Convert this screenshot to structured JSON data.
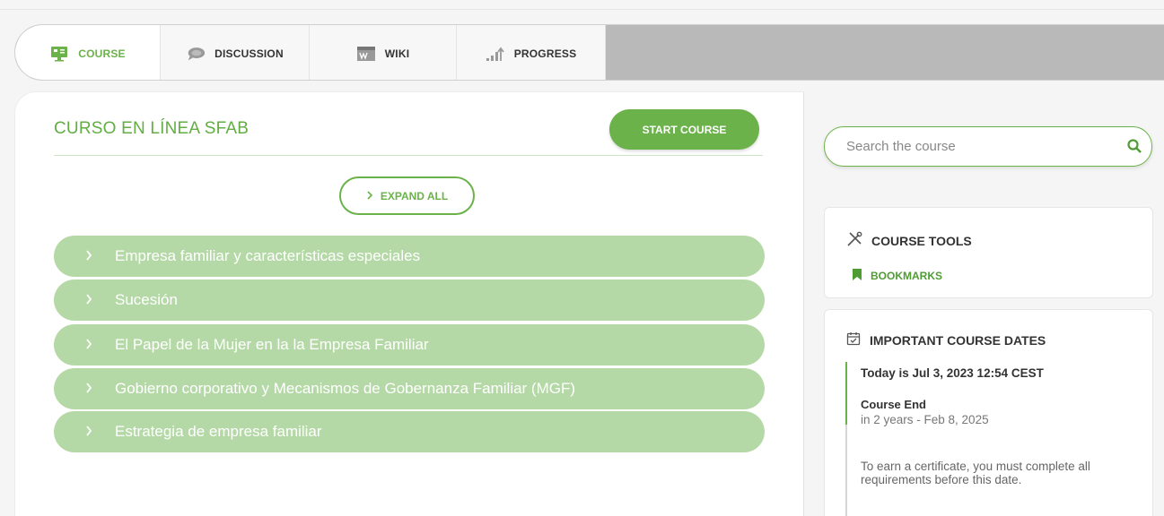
{
  "tabs": [
    {
      "label": "COURSE",
      "icon": "monitor-icon",
      "active": true
    },
    {
      "label": "DISCUSSION",
      "icon": "chat-icon",
      "active": false
    },
    {
      "label": "WIKI",
      "icon": "wiki-icon",
      "active": false
    },
    {
      "label": "PROGRESS",
      "icon": "progress-icon",
      "active": false
    }
  ],
  "course": {
    "title": "CURSO EN LÍNEA SFAB",
    "start_label": "START COURSE",
    "expand_label": "EXPAND ALL",
    "sections": [
      "Empresa familiar y características especiales",
      "Sucesión",
      "El Papel de la Mujer en la la Empresa Familiar",
      "Gobierno corporativo y Mecanismos de Gobernanza Familiar (MGF)",
      "Estrategia de empresa familiar"
    ]
  },
  "search": {
    "placeholder": "Search the course"
  },
  "tools": {
    "title": "COURSE TOOLS",
    "bookmarks_label": "BOOKMARKS"
  },
  "dates": {
    "title": "IMPORTANT COURSE DATES",
    "today": "Today is Jul 3, 2023 12:54 CEST",
    "end_label": "Course End",
    "end_detail": "in 2 years - Feb 8, 2025",
    "note": "To earn a certificate, you must complete all requirements before this date."
  },
  "colors": {
    "accent": "#6cb24a",
    "section_bg": "#b5d9a6",
    "tab_bar": "#b9b9b9"
  }
}
